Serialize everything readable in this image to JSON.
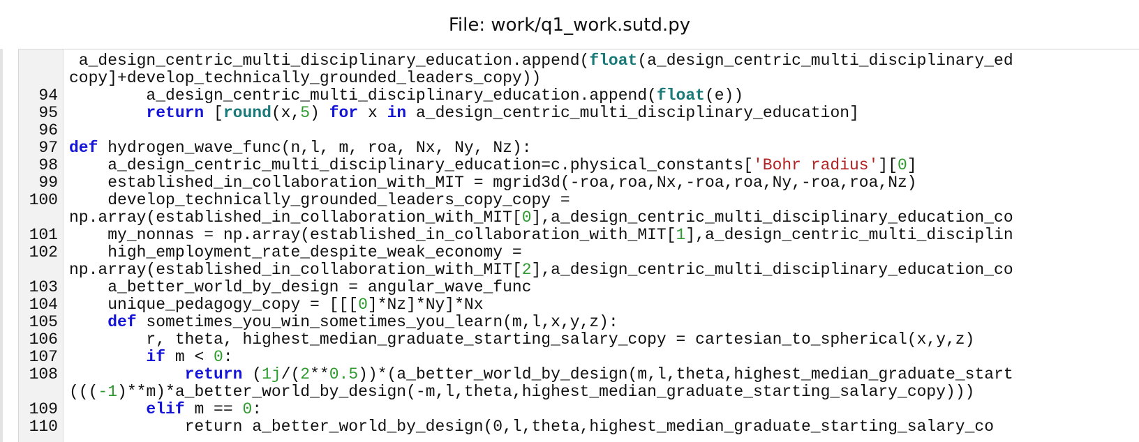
{
  "header": {
    "title": "File: work/q1_work.sutd.py"
  },
  "editor": {
    "lines": [
      {
        "num": "",
        "tokens": [
          [
            "p",
            " a_design_centric_multi_disciplinary_education.append("
          ],
          [
            "b",
            "float"
          ],
          [
            "p",
            "(a_design_centric_multi_disciplinary_ed"
          ]
        ]
      },
      {
        "num": "",
        "tokens": [
          [
            "p",
            "copy]+develop_technically_grounded_leaders_copy))"
          ]
        ]
      },
      {
        "num": "94",
        "tokens": [
          [
            "p",
            "        a_design_centric_multi_disciplinary_education.append("
          ],
          [
            "b",
            "float"
          ],
          [
            "p",
            "(e))"
          ]
        ]
      },
      {
        "num": "95",
        "tokens": [
          [
            "p",
            "        "
          ],
          [
            "k",
            "return"
          ],
          [
            "p",
            " ["
          ],
          [
            "b",
            "round"
          ],
          [
            "p",
            "(x,"
          ],
          [
            "n",
            "5"
          ],
          [
            "p",
            ") "
          ],
          [
            "k",
            "for"
          ],
          [
            "p",
            " x "
          ],
          [
            "k",
            "in"
          ],
          [
            "p",
            " a_design_centric_multi_disciplinary_education]"
          ]
        ]
      },
      {
        "num": "96",
        "tokens": []
      },
      {
        "num": "97",
        "tokens": [
          [
            "k",
            "def"
          ],
          [
            "p",
            " hydrogen_wave_func(n,l, m, roa, Nx, Ny, Nz):"
          ]
        ]
      },
      {
        "num": "98",
        "tokens": [
          [
            "p",
            "    a_design_centric_multi_disciplinary_education=c.physical_constants["
          ],
          [
            "s",
            "'Bohr radius'"
          ],
          [
            "p",
            "]["
          ],
          [
            "n",
            "0"
          ],
          [
            "p",
            "]"
          ]
        ]
      },
      {
        "num": "99",
        "tokens": [
          [
            "p",
            "    established_in_collaboration_with_MIT = mgrid3d(-roa,roa,Nx,-roa,roa,Ny,-roa,roa,Nz)"
          ]
        ]
      },
      {
        "num": "100",
        "tokens": [
          [
            "p",
            "    develop_technically_grounded_leaders_copy_copy ="
          ]
        ]
      },
      {
        "num": "",
        "tokens": [
          [
            "p",
            "np.array(established_in_collaboration_with_MIT["
          ],
          [
            "n",
            "0"
          ],
          [
            "p",
            "],a_design_centric_multi_disciplinary_education_co"
          ]
        ]
      },
      {
        "num": "101",
        "tokens": [
          [
            "p",
            "    my_nonnas = np.array(established_in_collaboration_with_MIT["
          ],
          [
            "n",
            "1"
          ],
          [
            "p",
            "],a_design_centric_multi_disciplin"
          ]
        ]
      },
      {
        "num": "102",
        "tokens": [
          [
            "p",
            "    high_employment_rate_despite_weak_economy ="
          ]
        ]
      },
      {
        "num": "",
        "tokens": [
          [
            "p",
            "np.array(established_in_collaboration_with_MIT["
          ],
          [
            "n",
            "2"
          ],
          [
            "p",
            "],a_design_centric_multi_disciplinary_education_co"
          ]
        ]
      },
      {
        "num": "103",
        "tokens": [
          [
            "p",
            "    a_better_world_by_design = angular_wave_func"
          ]
        ]
      },
      {
        "num": "104",
        "tokens": [
          [
            "p",
            "    unique_pedagogy_copy = [[["
          ],
          [
            "n",
            "0"
          ],
          [
            "p",
            "]*Nz]*Ny]*Nx"
          ]
        ]
      },
      {
        "num": "105",
        "tokens": [
          [
            "p",
            "    "
          ],
          [
            "k",
            "def"
          ],
          [
            "p",
            " sometimes_you_win_sometimes_you_learn(m,l,x,y,z):"
          ]
        ]
      },
      {
        "num": "106",
        "tokens": [
          [
            "p",
            "        r, theta, highest_median_graduate_starting_salary_copy = cartesian_to_spherical(x,y,z)"
          ]
        ]
      },
      {
        "num": "107",
        "tokens": [
          [
            "p",
            "        "
          ],
          [
            "k",
            "if"
          ],
          [
            "p",
            " m < "
          ],
          [
            "n",
            "0"
          ],
          [
            "p",
            ":"
          ]
        ]
      },
      {
        "num": "108",
        "tokens": [
          [
            "p",
            "            "
          ],
          [
            "k",
            "return"
          ],
          [
            "p",
            " ("
          ],
          [
            "n",
            "1j"
          ],
          [
            "p",
            "/("
          ],
          [
            "n",
            "2"
          ],
          [
            "p",
            "**"
          ],
          [
            "n",
            "0.5"
          ],
          [
            "p",
            "))*(a_better_world_by_design(m,l,theta,highest_median_graduate_start"
          ]
        ]
      },
      {
        "num": "",
        "tokens": [
          [
            "p",
            "((("
          ],
          [
            "n",
            "-1"
          ],
          [
            "p",
            ")**m)*a_better_world_by_design(-m,l,theta,highest_median_graduate_starting_salary_copy)))"
          ]
        ]
      },
      {
        "num": "109",
        "tokens": [
          [
            "p",
            "        "
          ],
          [
            "k",
            "elif"
          ],
          [
            "p",
            " m == "
          ],
          [
            "n",
            "0"
          ],
          [
            "p",
            ":"
          ]
        ]
      },
      {
        "num": "110",
        "tokens": [
          [
            "p",
            "            return a_better_world_by_design(0,l,theta,highest_median_graduate_starting_salary_co"
          ]
        ]
      }
    ]
  }
}
